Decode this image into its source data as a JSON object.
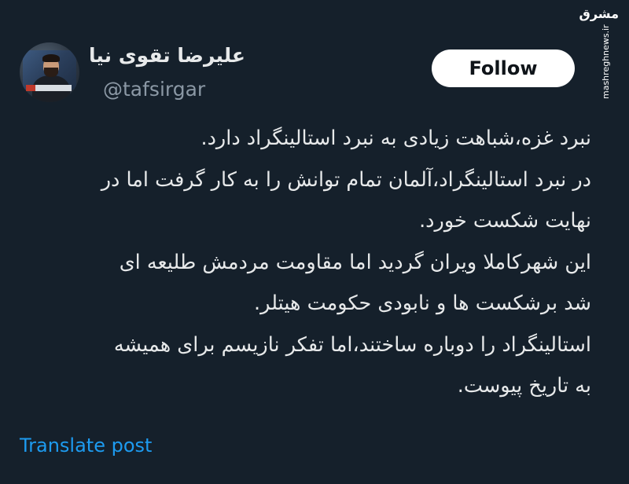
{
  "profile": {
    "display_name": "علیرضا تقوی نیا",
    "handle": "@tafsirgar",
    "avatar_icon": "user-avatar"
  },
  "follow_button": {
    "label": "Follow"
  },
  "watermark": {
    "logo_text": "مشرق",
    "url": "mashreghnews.ir"
  },
  "tweet": {
    "lines": [
      "نبرد غزه،شباهت زیادی به نبرد استالینگراد دارد.",
      "در نبرد استالینگراد،آلمان تمام توانش را به کار گرفت اما در",
      "نهایت شکست خورد.",
      "این شهرکاملا ویران گردید اما مقاومت مردمش طلیعه ای",
      "شد برشکست ها و نابودی حکومت هیتلر.",
      "استالینگراد را دوباره ساختند،اما تفکر نازیسم برای همیشه",
      "به تاریخ پیوست."
    ]
  },
  "actions": {
    "translate_label": "Translate post"
  },
  "colors": {
    "background": "#15202b",
    "text_primary": "#e7e9ea",
    "text_secondary": "#8b98a5",
    "link": "#1d9bf0",
    "button_bg": "#ffffff",
    "button_text": "#0f1419"
  }
}
